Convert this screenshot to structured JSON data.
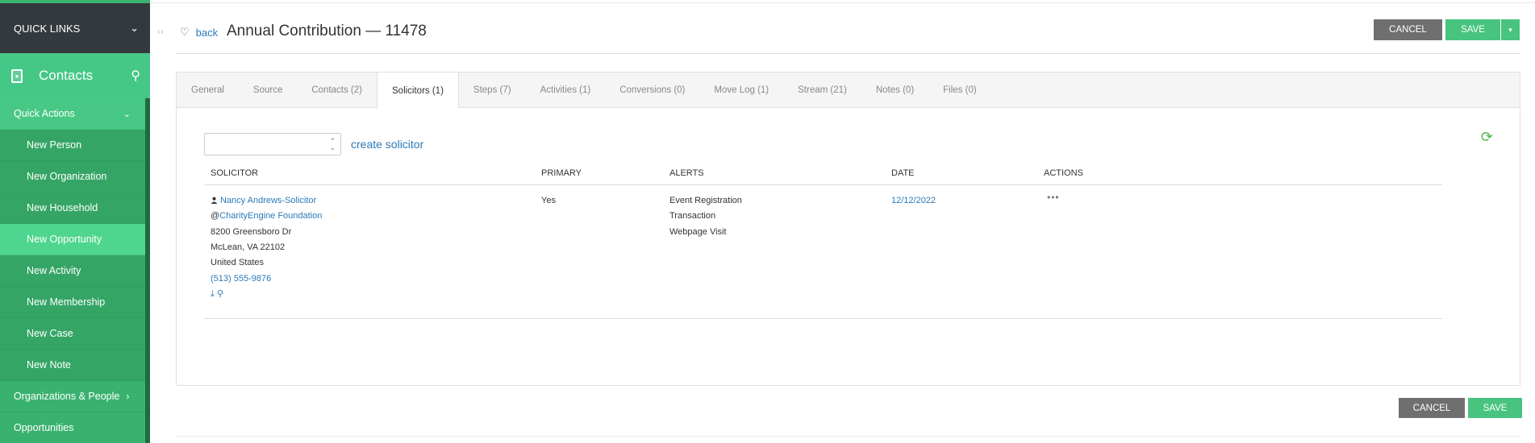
{
  "sidebar": {
    "quick_links": "QUICK LINKS",
    "module_title": "Contacts",
    "items": [
      {
        "label": "Quick Actions",
        "type": "section",
        "chevron": "down"
      },
      {
        "label": "New Person",
        "type": "sub"
      },
      {
        "label": "New Organization",
        "type": "sub"
      },
      {
        "label": "New Household",
        "type": "sub"
      },
      {
        "label": "New Opportunity",
        "type": "sub",
        "highlight": true
      },
      {
        "label": "New Activity",
        "type": "sub"
      },
      {
        "label": "New Membership",
        "type": "sub"
      },
      {
        "label": "New Case",
        "type": "sub"
      },
      {
        "label": "New Note",
        "type": "sub"
      },
      {
        "label": "Organizations & People",
        "type": "section",
        "chevron": "right"
      },
      {
        "label": "Opportunities",
        "type": "section"
      }
    ]
  },
  "header": {
    "back_label": "back",
    "title": "Annual Contribution — 11478",
    "cancel_label": "CANCEL",
    "save_label": "SAVE"
  },
  "tabs": [
    {
      "label": "General"
    },
    {
      "label": "Source"
    },
    {
      "label": "Contacts (2)"
    },
    {
      "label": "Solicitors (1)",
      "active": true
    },
    {
      "label": "Steps (7)"
    },
    {
      "label": "Activities (1)"
    },
    {
      "label": "Conversions (0)"
    },
    {
      "label": "Move Log (1)"
    },
    {
      "label": "Stream (21)"
    },
    {
      "label": "Notes (0)"
    },
    {
      "label": "Files (0)"
    }
  ],
  "solicitors": {
    "select_value": "",
    "create_label": "create solicitor",
    "columns": {
      "solicitor": "SOLICITOR",
      "primary": "PRIMARY",
      "alerts": "ALERTS",
      "date": "DATE",
      "actions": "ACTIONS"
    },
    "rows": [
      {
        "name": "Nancy Andrews-Solicitor",
        "org_prefix": "@",
        "organization": "CharityEngine Foundation",
        "address1": "8200 Greensboro Dr",
        "address2": "McLean, VA 22102",
        "country": "United States",
        "phone": "(513) 555-9876",
        "primary": "Yes",
        "alerts": [
          "Event Registration",
          "Transaction",
          "Webpage Visit"
        ],
        "date": "12/12/2022",
        "actions_icon": "ellipsis-icon"
      }
    ]
  },
  "footer": {
    "cancel_label": "CANCEL",
    "save_label": "SAVE"
  },
  "colors": {
    "sidebar": "#3cb371",
    "sidebar_dark": "#34393e",
    "save": "#48c47f",
    "cancel": "#6f6f6f",
    "link": "#2a7ab8"
  }
}
